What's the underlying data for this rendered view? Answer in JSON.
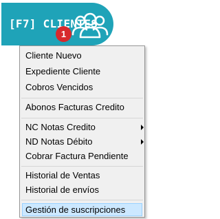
{
  "button": {
    "label": "[F7] CLIENTES",
    "icon": "users-group-icon",
    "badge_count": "1"
  },
  "colors": {
    "button_bg": "#1fa3b8",
    "badge_bg": "#d7292c",
    "menu_bg": "#f0f0f0",
    "highlight_bg": "#cce8ff"
  },
  "menu": {
    "items": [
      {
        "label": "Cliente Nuevo"
      },
      {
        "label": "Expediente Cliente"
      },
      {
        "label": "Cobros Vencidos"
      },
      {
        "label": "Abonos Facturas Credito"
      },
      {
        "label": "NC Notas Credito",
        "submenu": true
      },
      {
        "label": "ND Notas Débito",
        "submenu": true
      },
      {
        "label": "Cobrar Factura Pendiente"
      },
      {
        "label": "Historial de Ventas"
      },
      {
        "label": "Historial de envíos"
      },
      {
        "label": "Gestión de suscripciones",
        "highlighted": true
      }
    ]
  }
}
